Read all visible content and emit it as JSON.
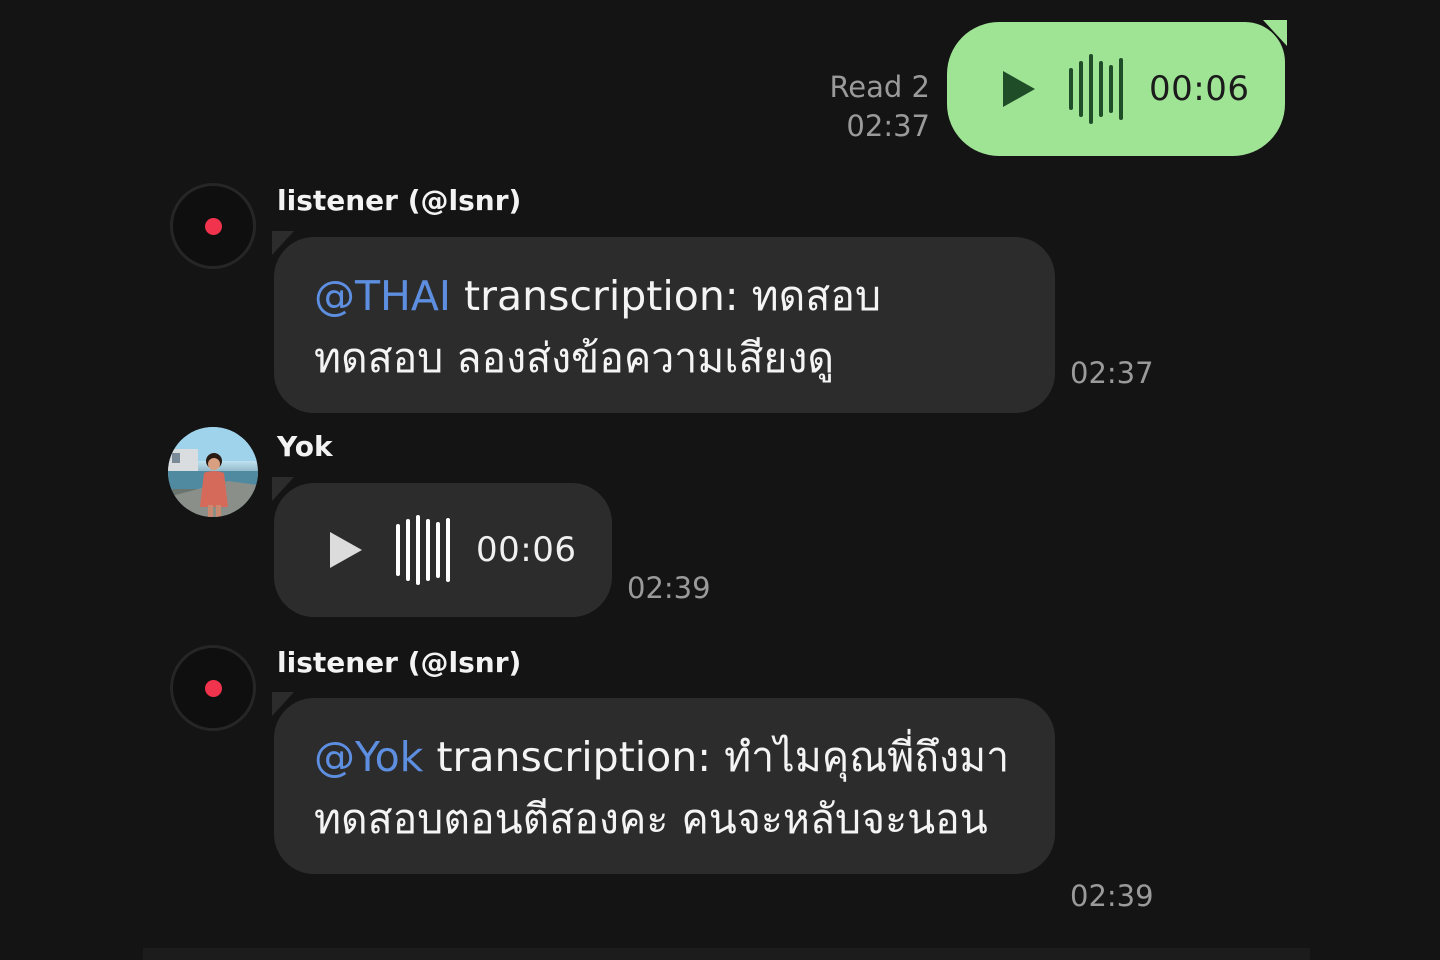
{
  "outgoing_voice": {
    "read_status": "Read 2",
    "time": "02:37",
    "duration": "00:06",
    "bubble_color": "#9fe495"
  },
  "messages": [
    {
      "sender": "listener (@lsnr)",
      "mention": "@THAI",
      "text": " transcription: ทดสอบ ทดสอบ ลองส่งข้อความเสียงดู",
      "time": "02:37"
    },
    {
      "sender": "Yok",
      "type": "voice",
      "duration": "00:06",
      "time": "02:39"
    },
    {
      "sender": "listener (@lsnr)",
      "mention": "@Yok",
      "text": " transcription: ทำไมคุณพี่ถึงมาทดสอบตอนตีสองคะ คนจะหลับจะนอน",
      "time": "02:39"
    }
  ],
  "colors": {
    "background": "#141414",
    "incoming_bubble": "#2c2c2c",
    "mention": "#5d8ee0",
    "bot_dot": "#f2334d"
  }
}
